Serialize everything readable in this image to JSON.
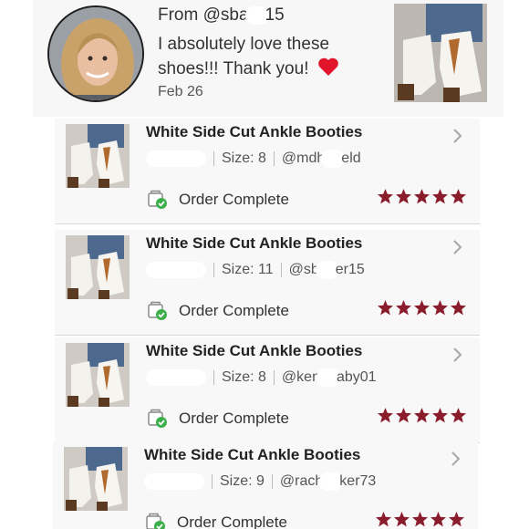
{
  "review": {
    "from_prefix": "From @sba",
    "from_suffix": "15",
    "text": "I absolutely love these shoes!!! Thank you!",
    "date": "Feb 26"
  },
  "colors": {
    "star": "#8a1c2c",
    "heart": "#e0152b",
    "check": "#3cae4a"
  },
  "orders": [
    {
      "title": "White Side Cut Ankle Booties",
      "size": "Size: 8",
      "handle_a": "@mdh",
      "handle_b": "eld",
      "status": "Order Complete",
      "rating": 5
    },
    {
      "title": "White Side Cut Ankle Booties",
      "size": "Size: 11",
      "handle_a": "@sb",
      "handle_b": "er15",
      "status": "Order Complete",
      "rating": 5
    },
    {
      "title": "White Side Cut Ankle Booties",
      "size": "Size: 8",
      "handle_a": "@ken",
      "handle_b": "aby01",
      "status": "Order Complete",
      "rating": 5
    },
    {
      "title": "White Side Cut Ankle Booties",
      "size": "Size: 9",
      "handle_a": "@rach",
      "handle_b": "ker73",
      "status": "Order Complete",
      "rating": 5
    }
  ]
}
